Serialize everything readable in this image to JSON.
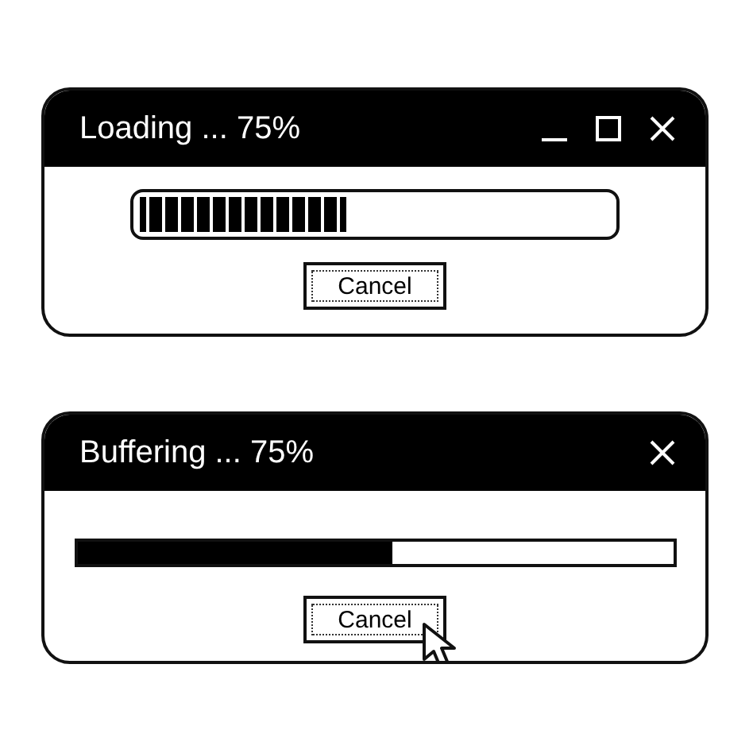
{
  "windows": [
    {
      "title": "Loading ... 75%",
      "controls": [
        {
          "kind": "minimize"
        },
        {
          "kind": "maximize"
        },
        {
          "kind": "close"
        }
      ],
      "progress": {
        "kind": "segmented",
        "level": 0.44
      },
      "button": "Cancel",
      "cursor": false
    },
    {
      "title": "Buffering ... 75%",
      "controls": [
        {
          "kind": "close"
        }
      ],
      "progress": {
        "kind": "solid",
        "level": 0.53
      },
      "button": "Cancel",
      "cursor": true
    }
  ]
}
